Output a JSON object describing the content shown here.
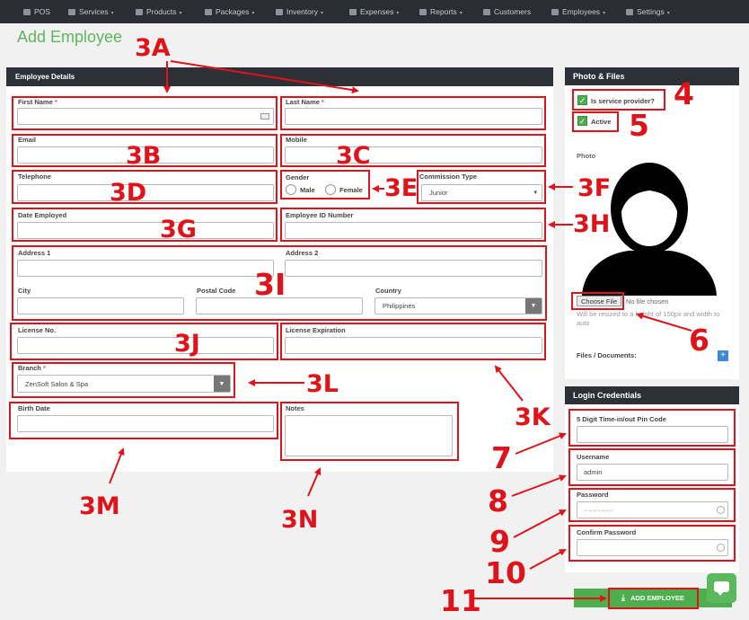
{
  "nav": {
    "items": [
      {
        "label": "POS",
        "caret": ""
      },
      {
        "label": "Services",
        "caret": "▾"
      },
      {
        "label": "Products",
        "caret": "▾"
      },
      {
        "label": "Packages",
        "caret": "▾"
      },
      {
        "label": "Inventory",
        "caret": "▾"
      },
      {
        "label": "Expenses",
        "caret": "▾"
      },
      {
        "label": "Reports",
        "caret": "▾"
      },
      {
        "label": "Customers",
        "caret": ""
      },
      {
        "label": "Employees",
        "caret": "▾"
      },
      {
        "label": "Settings",
        "caret": "▾"
      }
    ]
  },
  "page": {
    "title": "Add Employee"
  },
  "employee_details": {
    "title": "Employee Details",
    "first_name": {
      "label": "First Name",
      "required": "*",
      "value": ""
    },
    "last_name": {
      "label": "Last Name",
      "required": "*",
      "value": ""
    },
    "email": {
      "label": "Email",
      "value": ""
    },
    "mobile": {
      "label": "Mobile",
      "value": ""
    },
    "telephone": {
      "label": "Telephone",
      "value": ""
    },
    "gender": {
      "label": "Gender",
      "options": [
        "Male",
        "Female"
      ]
    },
    "commission_type": {
      "label": "Commission Type",
      "value": "Junior"
    },
    "date_employed": {
      "label": "Date Employed",
      "value": ""
    },
    "employee_id": {
      "label": "Employee ID Number",
      "value": ""
    },
    "address1": {
      "label": "Address 1",
      "value": ""
    },
    "address2": {
      "label": "Address 2",
      "value": ""
    },
    "city": {
      "label": "City",
      "value": ""
    },
    "postal_code": {
      "label": "Postal Code",
      "value": ""
    },
    "country": {
      "label": "Country",
      "value": "Philippines"
    },
    "license_no": {
      "label": "License No.",
      "value": ""
    },
    "license_expiration": {
      "label": "License Expiration",
      "value": ""
    },
    "branch": {
      "label": "Branch",
      "required": "*",
      "value": "ZenSoft Salon & Spa"
    },
    "birth_date": {
      "label": "Birth Date",
      "value": ""
    },
    "notes": {
      "label": "Notes",
      "value": ""
    }
  },
  "photo_files": {
    "title": "Photo & Files",
    "service_provider_label": "Is service provider?",
    "active_label": "Active",
    "photo_label": "Photo",
    "choose_file": "Choose File",
    "no_file": "No file chosen",
    "resize_note": "Will be resized to a height of 150px and width to auto",
    "files_label": "Files / Documents:"
  },
  "login": {
    "title": "Login Credentials",
    "pin": {
      "label": "5 Digit Time-in/out Pin Code",
      "value": ""
    },
    "username": {
      "label": "Username",
      "value": "admin"
    },
    "password": {
      "label": "Password",
      "value": "·············"
    },
    "confirm_password": {
      "label": "Confirm Password",
      "value": ""
    }
  },
  "actions": {
    "add_employee": "ADD EMPLOYEE"
  },
  "annotations": {
    "a3A": "3A",
    "a3B": "3B",
    "a3C": "3C",
    "a3D": "3D",
    "a3E": "3E",
    "a3F": "3F",
    "a3G": "3G",
    "a3H": "3H",
    "a3I": "3I",
    "a3J": "3J",
    "a3K": "3K",
    "a3L": "3L",
    "a3M": "3M",
    "a3N": "3N",
    "a4": "4",
    "a5": "5",
    "a6": "6",
    "a7": "7",
    "a8": "8",
    "a9": "9",
    "a10": "10",
    "a11": "11"
  },
  "colors": {
    "accent_green": "#5cb85c",
    "nav_bg": "#2b2d34",
    "annotation_red": "#e0131a"
  }
}
